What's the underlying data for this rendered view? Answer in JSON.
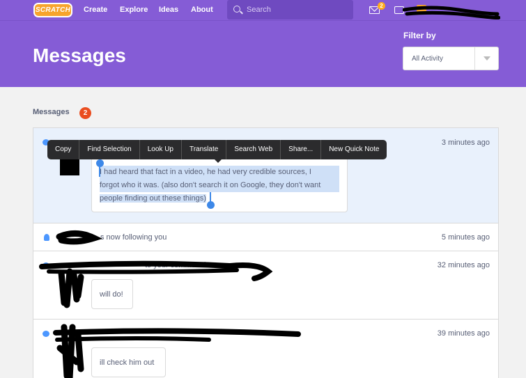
{
  "nav": {
    "logo": "SCRATCH",
    "links": [
      "Create",
      "Explore",
      "Ideas",
      "About"
    ],
    "search_placeholder": "Search",
    "message_count": "2"
  },
  "header": {
    "title": "Messages",
    "filter_label": "Filter by",
    "filter_value": "All Activity"
  },
  "section": {
    "title": "Messages",
    "count": "2"
  },
  "context_menu": {
    "items": [
      "Copy",
      "Find Selection",
      "Look Up",
      "Translate",
      "Search Web",
      "Share...",
      "New Quick Note"
    ]
  },
  "messages": [
    {
      "time": "3 minutes ago",
      "comment_lines": [
        "I had heard that fact in a video, he had very credible sources, I",
        "forgot who it was. (also don't search it on Google, they don't want",
        "people finding out these things)"
      ]
    },
    {
      "text": "s now following you",
      "time": "5 minutes ago"
    },
    {
      "text": "to your comment in",
      "time": "32 minutes ago",
      "comment": "will do!"
    },
    {
      "time": "39 minutes ago",
      "comment": "ill check him out"
    }
  ]
}
